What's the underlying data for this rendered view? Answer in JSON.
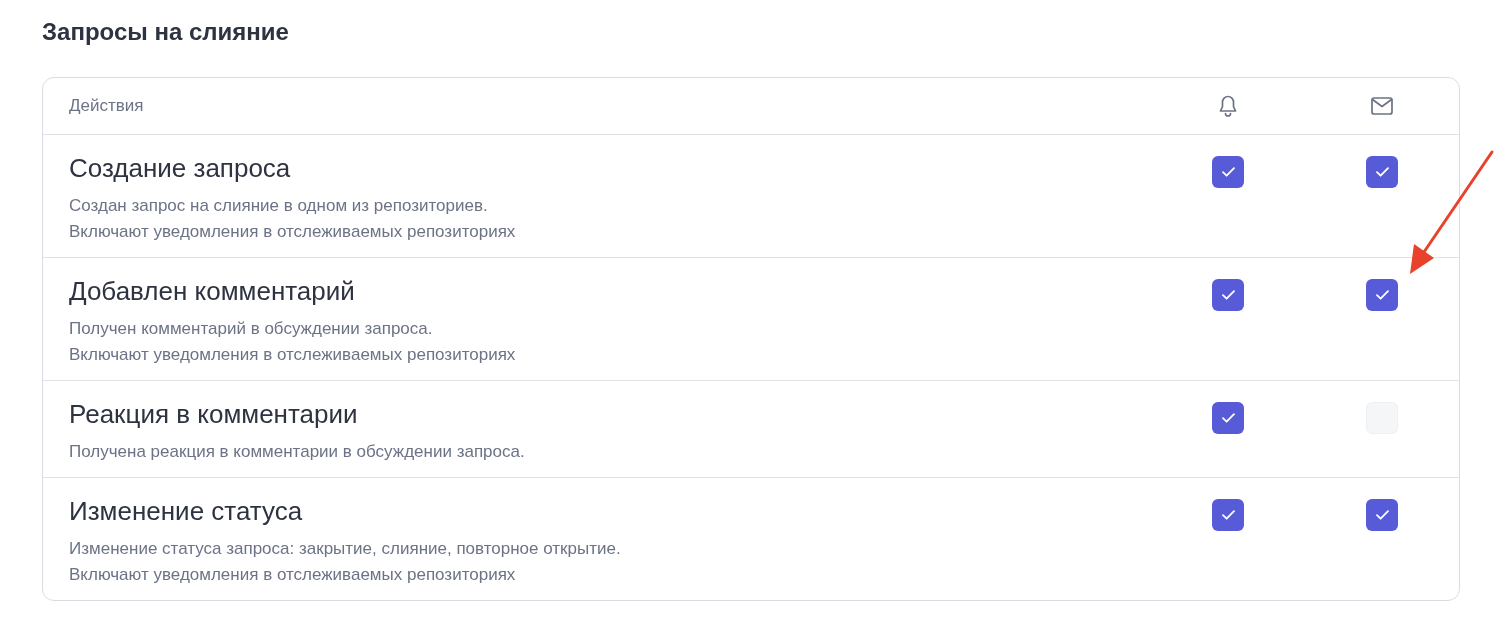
{
  "section_title": "Запросы на слияние",
  "table": {
    "header_label": "Действия",
    "rows": [
      {
        "title": "Создание запроса",
        "description": [
          "Создан запрос на слияние в одном из репозиториев.",
          "Включают уведомления в отслеживаемых репозиториях"
        ],
        "checks": [
          {
            "checked": true
          },
          {
            "checked": true
          }
        ]
      },
      {
        "title": "Добавлен комментарий",
        "description": [
          "Получен комментарий в обсуждении запроса.",
          "Включают уведомления в отслеживаемых репозиториях"
        ],
        "checks": [
          {
            "checked": true
          },
          {
            "checked": true
          }
        ]
      },
      {
        "title": "Реакция в комментарии",
        "description": [
          "Получена реакция в комментарии в обсуждении запроса."
        ],
        "checks": [
          {
            "checked": true
          },
          {
            "checked": false
          }
        ]
      },
      {
        "title": "Изменение статуса",
        "description": [
          "Изменение статуса запроса: закрытие, слияние, повторное открытие.",
          "Включают уведомления в отслеживаемых репозиториях"
        ],
        "checks": [
          {
            "checked": true
          },
          {
            "checked": true
          }
        ]
      }
    ]
  }
}
